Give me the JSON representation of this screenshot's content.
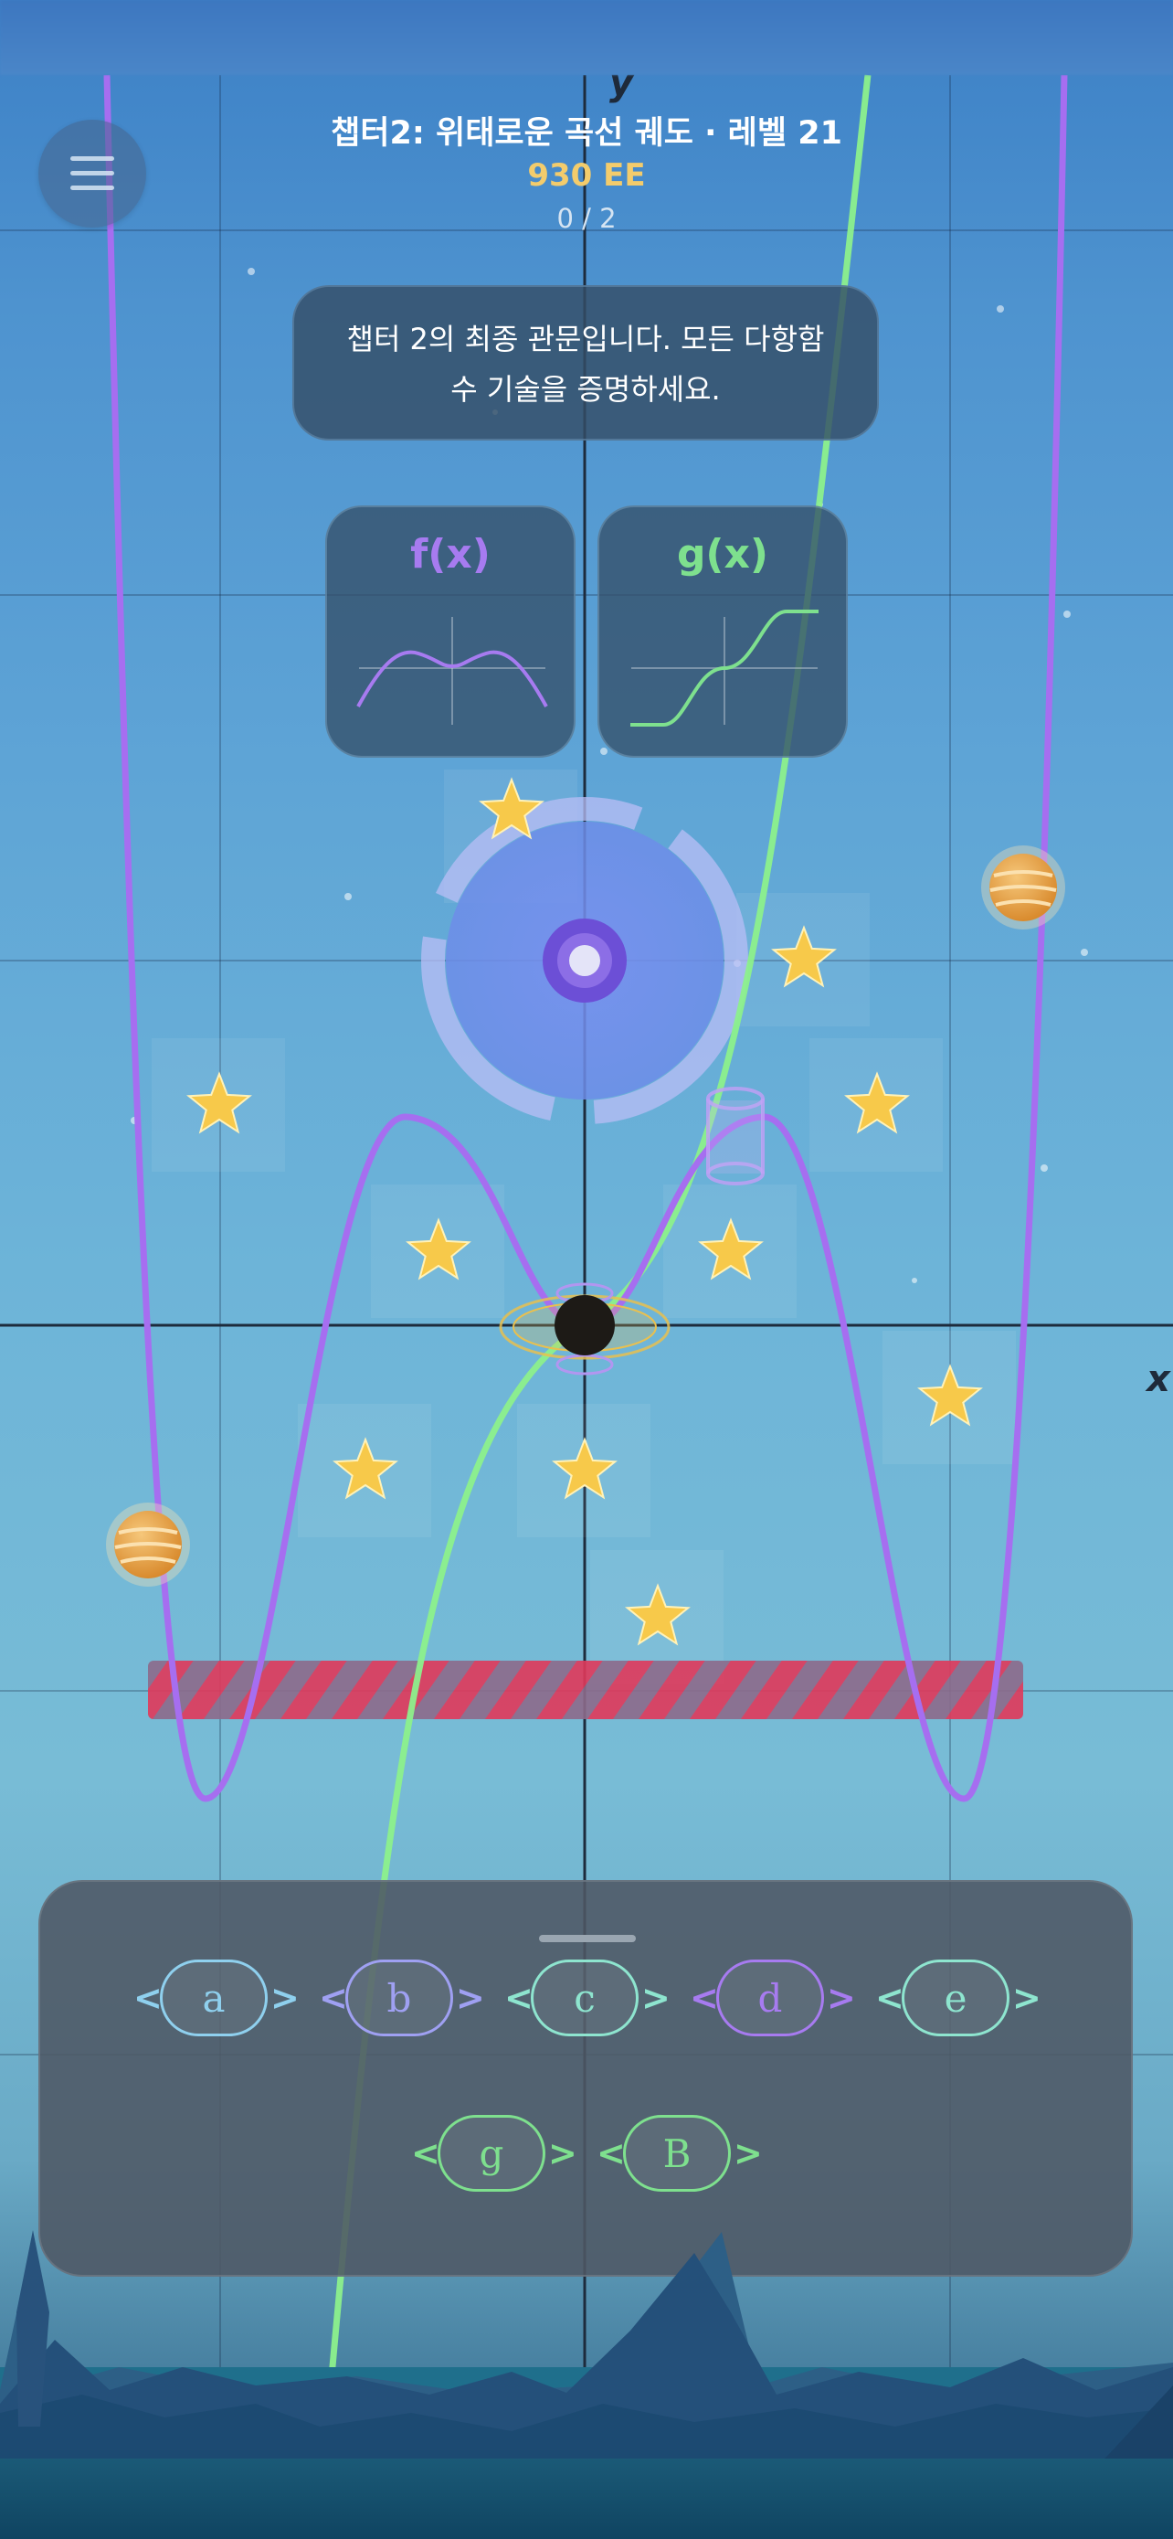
{
  "hud": {
    "level_title": "챕터2: 위태로운 곡선 궤도 · 레벨 21",
    "score": "930 EE",
    "progress": "0 / 2"
  },
  "hint": {
    "line1": "챕터 2의 최종 관문입니다. 모든 다항함",
    "line2": "수 기술을 증명하세요."
  },
  "axes": {
    "x_label": "x",
    "y_label": "y"
  },
  "function_cards": [
    {
      "label": "f(x)",
      "color": "#a77bf0"
    },
    {
      "label": "g(x)",
      "color": "#7ee08e"
    }
  ],
  "parameters": [
    {
      "name": "a",
      "left_arrow": "<",
      "right_arrow": ">",
      "color": "#8fd0ee"
    },
    {
      "name": "b",
      "left_arrow": "<",
      "right_arrow": ">",
      "color": "#9fa0f2"
    },
    {
      "name": "c",
      "left_arrow": "<",
      "right_arrow": ">",
      "color": "#8ee5cf"
    },
    {
      "name": "d",
      "left_arrow": "<",
      "right_arrow": ">",
      "color": "#a77bf0"
    },
    {
      "name": "e",
      "left_arrow": "<",
      "right_arrow": ">",
      "color": "#8ee5cf"
    },
    {
      "name": "g",
      "left_arrow": "<",
      "right_arrow": ">",
      "color": "#7ee08e"
    },
    {
      "name": "B",
      "left_arrow": "<",
      "right_arrow": ">",
      "color": "#7ee08e"
    }
  ],
  "colors": {
    "f_curve": "#a66ef0",
    "g_curve": "#8cf08c",
    "star": "#f7c94a",
    "hazard_red": "#e0385a",
    "planet": "#e8a64a"
  },
  "icons": [
    "menu-icon",
    "star-icon",
    "planet-icon",
    "portal-icon",
    "black-hole-icon",
    "hazard-bar"
  ]
}
